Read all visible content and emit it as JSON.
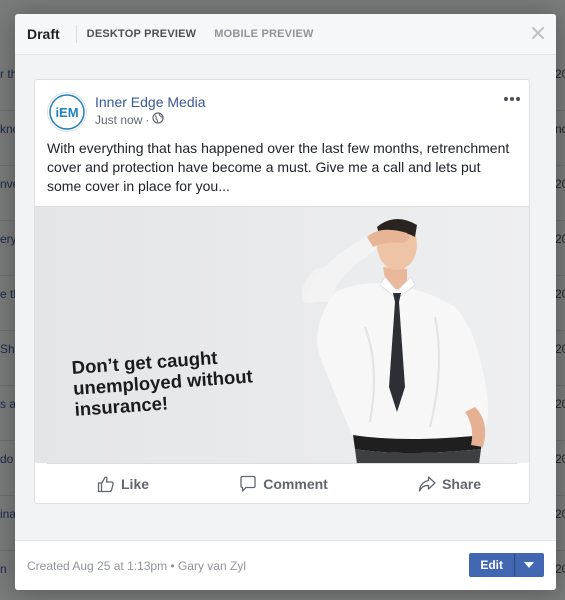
{
  "background": {
    "left_snippets": [
      "r th",
      "kno",
      "nve",
      "erfo",
      "eryt",
      "me",
      "e th",
      "Sh",
      "t's",
      "s a",
      "ect",
      "do",
      "ina",
      "for",
      "n",
      "who"
    ],
    "right_snippets": [
      "20",
      "nd",
      "20",
      "20",
      "20",
      "20",
      "20",
      "20",
      "20",
      "20",
      "20"
    ]
  },
  "dialog": {
    "title": "Draft",
    "tabs": [
      {
        "label": "DESKTOP PREVIEW",
        "active": true
      },
      {
        "label": "MOBILE PREVIEW",
        "active": false
      }
    ],
    "close_icon": "close-icon"
  },
  "post": {
    "page_name": "Inner Edge Media",
    "avatar_text": "iEM",
    "timestamp": "Just now",
    "separator": "·",
    "privacy_icon": "globe-icon",
    "more_icon": "more-icon",
    "text": "With everything that has happened over the last few months, retrenchment cover and protection have become a must. Give me a call and lets put some cover in place for you...",
    "image_caption_lines": [
      "Don’t get caught",
      "unemployed without",
      "insurance!"
    ],
    "actions": {
      "like": "Like",
      "comment": "Comment",
      "share": "Share"
    }
  },
  "footer": {
    "created_text": "Created Aug 25 at 1:13pm • Gary van Zyl",
    "edit_label": "Edit"
  },
  "colors": {
    "brand_blue": "#385898",
    "button_blue": "#4267b2",
    "avatar_blue": "#1d7fc4"
  }
}
